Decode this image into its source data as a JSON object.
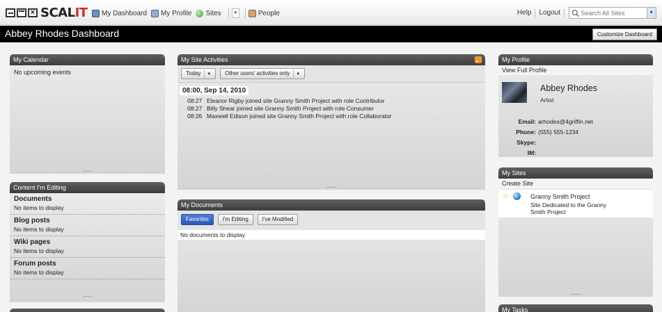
{
  "topnav": {
    "logo_text": "SCALIT",
    "logo_prefix": "SCAL",
    "logo_suffix": "IT",
    "links": [
      {
        "label": "My Dashboard",
        "icon": "dashboard-icon"
      },
      {
        "label": "My Profile",
        "icon": "profile-icon"
      },
      {
        "label": "Sites",
        "icon": "sites-globe-icon"
      },
      {
        "label": "People",
        "icon": "people-icon"
      }
    ],
    "help_label": "Help",
    "logout_label": "Logout",
    "search_placeholder": "Search All Sites"
  },
  "title": {
    "text": "Abbey Rhodes Dashboard",
    "customize_label": "Customize Dashboard"
  },
  "calendar": {
    "title": "My Calendar",
    "empty_text": "No upcoming events"
  },
  "editing": {
    "title": "Content I'm Editing",
    "sections": [
      {
        "heading": "Documents",
        "status": "No items to display"
      },
      {
        "heading": "Blog posts",
        "status": "No items to display"
      },
      {
        "heading": "Wiki pages",
        "status": "No items to display"
      },
      {
        "heading": "Forum posts",
        "status": "No items to display"
      }
    ]
  },
  "activities": {
    "title": "My Site Activities",
    "filter_range": "Today",
    "filter_user": "Other users' activities only",
    "date_heading": "08:00, Sep 14, 2010",
    "items": [
      {
        "time": "08:27",
        "text": "Eleanor Rigby joined site Granny Smith Project with role Contributor"
      },
      {
        "time": "08:27",
        "text": "Billy Shear joined site Granny Smith Project with role Consumer"
      },
      {
        "time": "08:26",
        "text": "Maxwell Edison joined site Granny Smith Project with role Collaborator"
      }
    ]
  },
  "documents": {
    "title": "My Documents",
    "tabs": [
      "Favorites",
      "I'm Editing",
      "I've Modified"
    ],
    "active_tab": "Favorites",
    "empty_text": "No documents to display"
  },
  "profile": {
    "title": "My Profile",
    "view_link": "View Full Profile",
    "name": "Abbey Rhodes",
    "role": "Artist",
    "fields": [
      {
        "label": "Email:",
        "value": "arhodes@4griffin.net"
      },
      {
        "label": "Phone:",
        "value": "(555) 555-1234"
      },
      {
        "label": "Skype:",
        "value": ""
      },
      {
        "label": "IM:",
        "value": ""
      }
    ]
  },
  "sites": {
    "title": "My Sites",
    "create_link": "Create Site",
    "items": [
      {
        "name": "Granny Smith Project",
        "description": "Site Dedicated to the Granny Smith Project"
      }
    ]
  },
  "tasks": {
    "title": "My Tasks"
  },
  "colors": {
    "header_dark": "#000000",
    "dashlet_header": "#4a4a4a",
    "accent_blue": "#2a58b6",
    "logo_red": "#d42a2a"
  }
}
